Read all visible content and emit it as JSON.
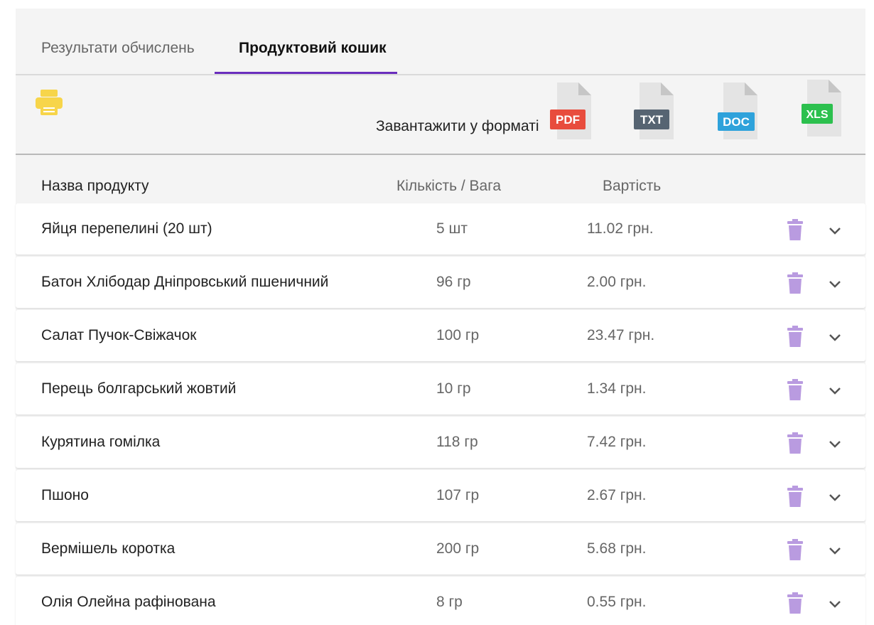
{
  "tabs": [
    {
      "label": "Результати обчислень",
      "active": false
    },
    {
      "label": "Продуктовий кошик",
      "active": true
    }
  ],
  "toolbar": {
    "print_icon": "printer-icon",
    "download_label": "Завантажити у форматі",
    "formats": [
      {
        "label": "PDF",
        "color": "#e84c3d"
      },
      {
        "label": "TXT",
        "color": "#566472"
      },
      {
        "label": "DOC",
        "color": "#2ea2db"
      },
      {
        "label": "XLS",
        "color": "#2cc04e"
      }
    ]
  },
  "table": {
    "headers": {
      "name": "Назва продукту",
      "qty": "Кількість / Вага",
      "cost": "Вартість"
    },
    "rows": [
      {
        "name": "Яйця перепелині (20 шт)",
        "qty": "5 шт",
        "cost": "11.02 грн."
      },
      {
        "name": "Батон Хлібодар Дніпровський пшеничний",
        "qty": "96 гр",
        "cost": "2.00 грн."
      },
      {
        "name": "Салат Пучок-Свіжачок",
        "qty": "100 гр",
        "cost": "23.47 грн."
      },
      {
        "name": "Перець болгарський жовтий",
        "qty": "10 гр",
        "cost": "1.34 грн."
      },
      {
        "name": "Курятина гомілка",
        "qty": "118 гр",
        "cost": "7.42 грн."
      },
      {
        "name": "Пшоно",
        "qty": "107 гр",
        "cost": "2.67 грн."
      },
      {
        "name": "Вермішель коротка",
        "qty": "200 гр",
        "cost": "5.68 грн."
      },
      {
        "name": "Олія Олейна рафінована",
        "qty": "8 гр",
        "cost": "0.55 грн."
      }
    ]
  },
  "colors": {
    "accent": "#6a2dbd",
    "print_icon": "#f7d54a",
    "trash_icon": "#b99be0"
  }
}
